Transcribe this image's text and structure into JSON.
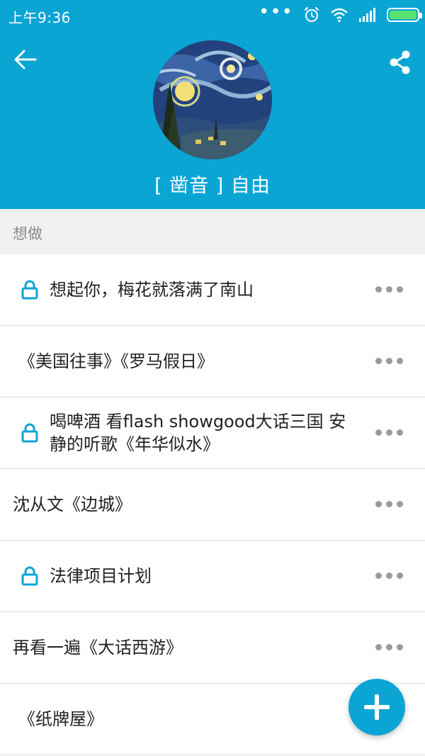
{
  "status_bar": {
    "time": "上午9:36",
    "more_dots": "•••",
    "icons": [
      "alarm-icon",
      "wifi-icon",
      "signal-icon",
      "battery-icon"
    ],
    "battery_level": 1.0
  },
  "header": {
    "back_icon": "arrow-left-icon",
    "share_icon": "share-icon",
    "avatar_image": "starry-night-painting",
    "profile_name": "[ 凿音 ] 自由",
    "background_color": "#0ba5d4"
  },
  "section": {
    "title": "想做"
  },
  "items": [
    {
      "text": "想起你，梅花就落满了南山",
      "locked": true
    },
    {
      "text": "《美国往事》《罗马假日》",
      "locked": false
    },
    {
      "text": "喝啤酒  看flash showgood大话三国 安静的听歌《年华似水》",
      "locked": true
    },
    {
      "text": "沈从文《边城》",
      "locked": false
    },
    {
      "text": "法律项目计划",
      "locked": true
    },
    {
      "text": "再看一遍《大话西游》",
      "locked": false
    },
    {
      "text": "《纸牌屋》",
      "locked": false
    }
  ],
  "fab": {
    "icon": "plus-icon",
    "color": "#0ba5d4"
  }
}
